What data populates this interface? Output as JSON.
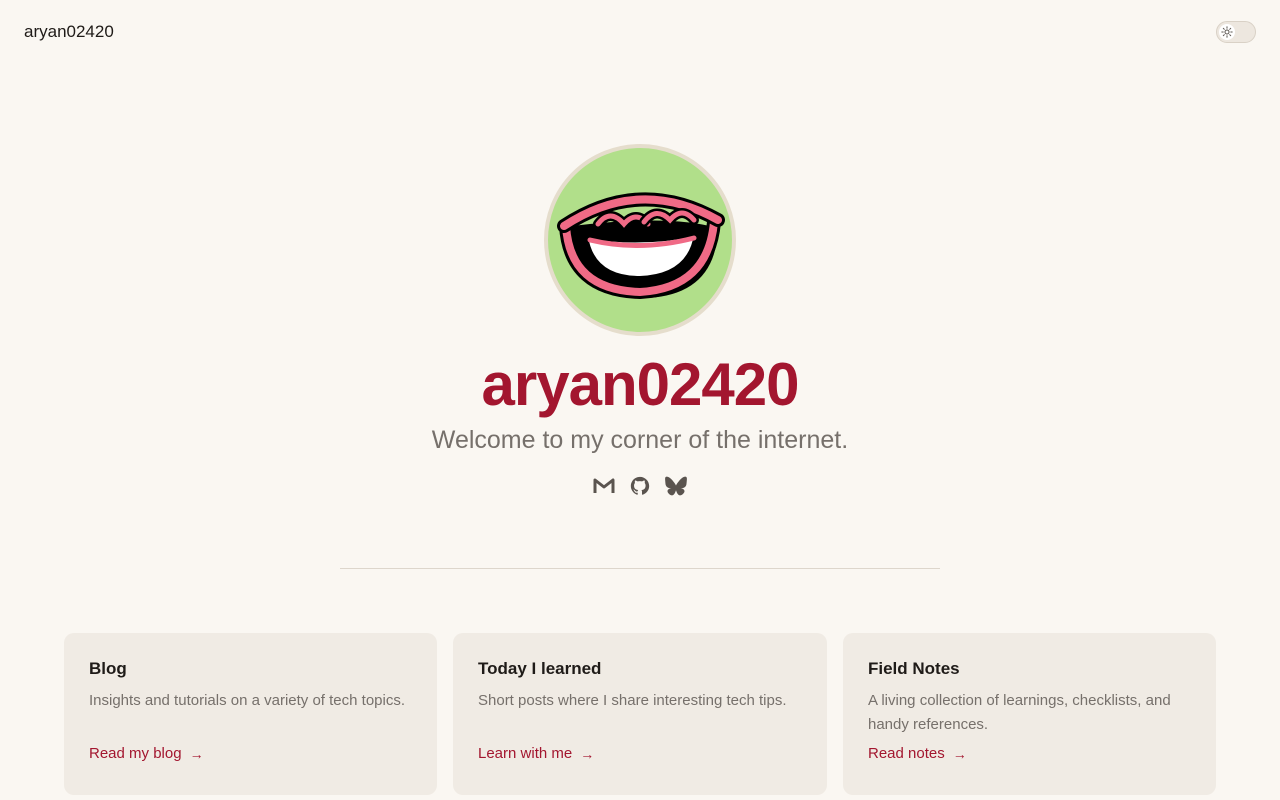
{
  "header": {
    "site_name": "aryan02420",
    "theme_toggle_icon": "sun-icon"
  },
  "hero": {
    "avatar_icon": "smiling-face-avatar",
    "title": "aryan02420",
    "subtitle": "Welcome to my corner of the internet.",
    "socials": [
      {
        "icon": "gmail-icon"
      },
      {
        "icon": "github-icon"
      },
      {
        "icon": "bluesky-icon"
      }
    ]
  },
  "cards": [
    {
      "title": "Blog",
      "description": "Insights and tutorials on a variety of tech topics.",
      "link": "Read my blog",
      "arrow": "→"
    },
    {
      "title": "Today I learned",
      "description": "Short posts where I share interesting tech tips.",
      "link": "Learn with me",
      "arrow": "→"
    },
    {
      "title": "Field Notes",
      "description": "A living collection of learnings, checklists, and handy references.",
      "link": "Read notes",
      "arrow": "→"
    }
  ],
  "colors": {
    "background": "#faf7f2",
    "accent": "#a3162f",
    "card_bg": "#f0ebe4",
    "avatar_bg": "#b1df8a"
  }
}
